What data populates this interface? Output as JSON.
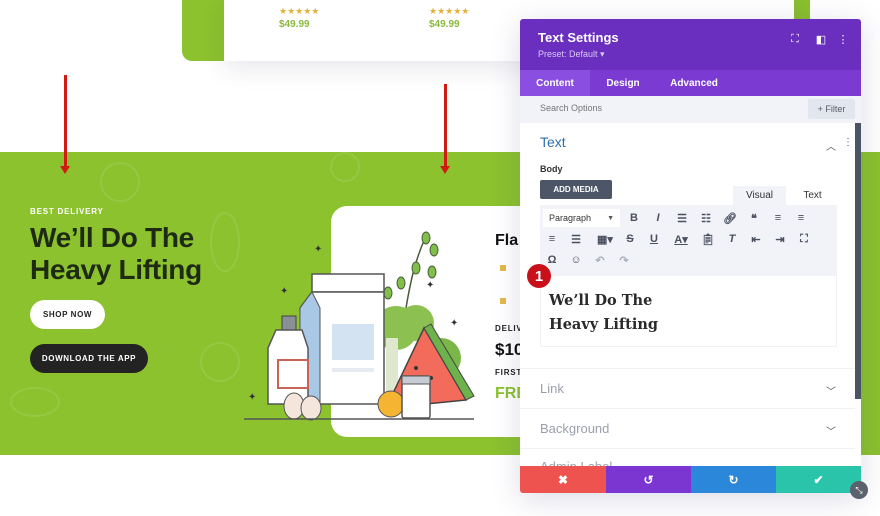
{
  "background_page": {
    "products": [
      {
        "rating": "★★★★★",
        "price": "$49.99"
      },
      {
        "rating": "★★★★★",
        "price": "$49.99"
      }
    ],
    "hero": {
      "kicker": "BEST DELIVERY",
      "title_line1": "We’ll Do The",
      "title_line2": "Heavy Lifting",
      "shop_button": "SHOP NOW",
      "app_button": "DOWNLOAD THE APP"
    },
    "promo_card": {
      "title": "Fla",
      "delivery_label": "DELIV",
      "price": "$10",
      "first_label": "FIRST",
      "free_label": "FRE"
    },
    "colors": {
      "brand_green": "#8bc22e",
      "annotation_red": "#d11b12"
    }
  },
  "modal": {
    "title": "Text Settings",
    "preset": "Preset: Default ▾",
    "header_icons": [
      "focus-icon",
      "split-view-icon",
      "more-vertical-icon"
    ],
    "tabs": [
      {
        "label": "Content",
        "active": true
      },
      {
        "label": "Design",
        "active": false
      },
      {
        "label": "Advanced",
        "active": false
      }
    ],
    "search_placeholder": "Search Options",
    "filter_label": "+ Filter",
    "text_section": {
      "heading": "Text",
      "body_label": "Body",
      "add_media": "ADD MEDIA",
      "editor_tabs": [
        "Visual",
        "Text"
      ],
      "format_select": "Paragraph",
      "content_line1": "We’ll Do The",
      "content_line2": "Heavy Lifting"
    },
    "annotation_badge": "1",
    "collapsed_sections": [
      "Link",
      "Background",
      "Admin Label"
    ],
    "footer": {
      "cancel": "✖",
      "undo": "↺",
      "redo": "↻",
      "save": "✔"
    },
    "colors": {
      "header": "#6a2fbf",
      "tabs": "#7b3bd3",
      "cancel": "#ef5350",
      "undo": "#7b35d0",
      "redo": "#2b87da",
      "save": "#29c4a9"
    }
  }
}
